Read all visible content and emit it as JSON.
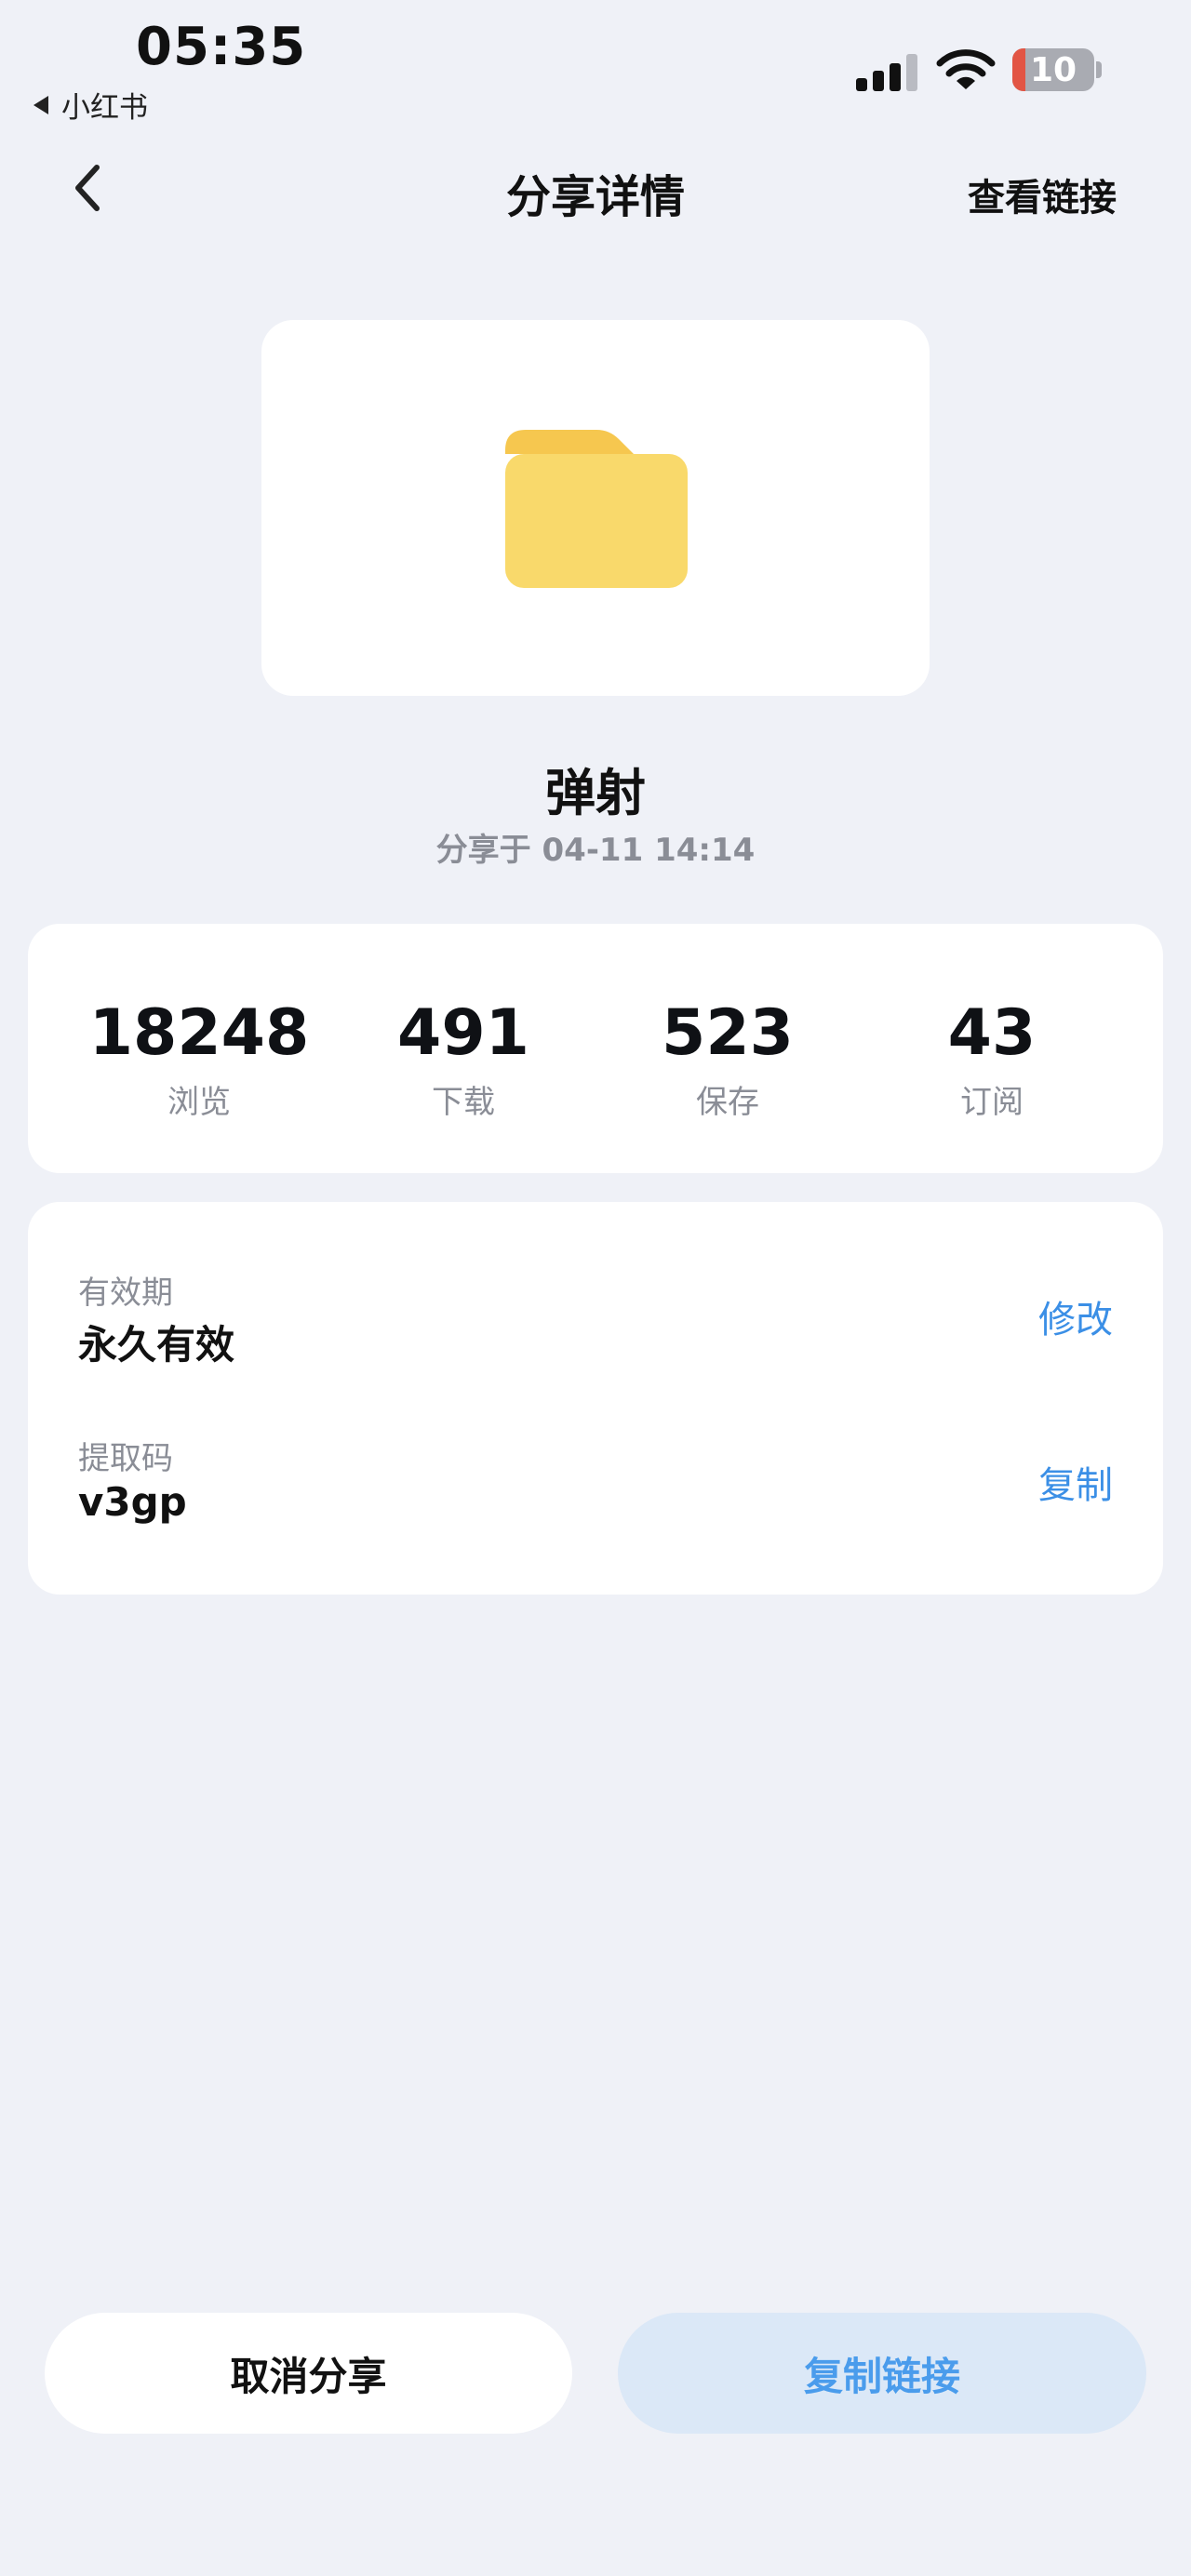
{
  "status_bar": {
    "time": "05:35",
    "back_app": "小红书",
    "battery": "10"
  },
  "nav": {
    "title": "分享详情",
    "link": "查看链接"
  },
  "file": {
    "name": "弹射",
    "share_time": "分享于 04-11 14:14",
    "folder_color": "#f9d96b"
  },
  "stats": [
    {
      "value": "18248",
      "label": "浏览"
    },
    {
      "value": "491",
      "label": "下载"
    },
    {
      "value": "523",
      "label": "保存"
    },
    {
      "value": "43",
      "label": "订阅"
    }
  ],
  "info": {
    "validity_label": "有效期",
    "validity_value": "永久有效",
    "validity_action": "修改",
    "code_label": "提取码",
    "code_value": "v3gp",
    "code_action": "复制"
  },
  "buttons": {
    "cancel": "取消分享",
    "copy": "复制链接"
  },
  "colors": {
    "accent": "#3b8fe6",
    "background": "#eff1f7",
    "copy_button_bg": "#dbe8f7"
  }
}
